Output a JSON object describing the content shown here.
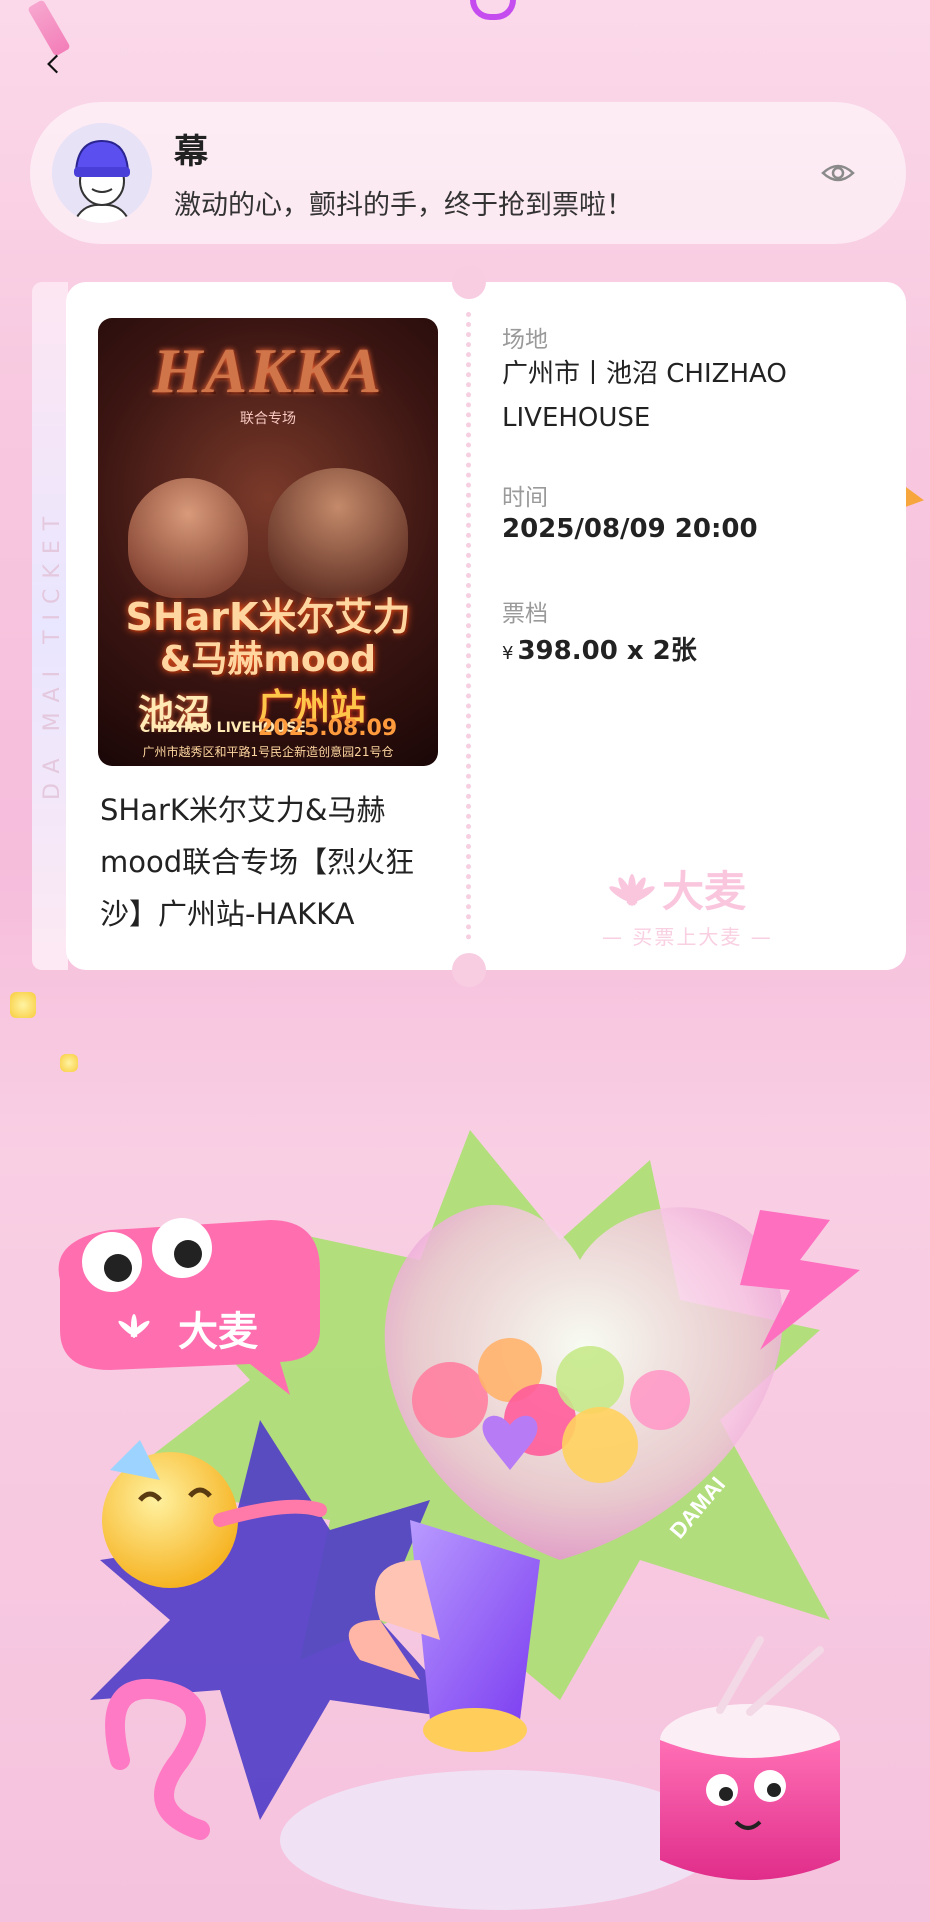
{
  "nav": {
    "back_icon": "chevron-left-icon"
  },
  "message": {
    "name": "幕",
    "text": "激动的心，颤抖的手，终于抢到票啦！",
    "visibility_icon": "eye-icon"
  },
  "ticket": {
    "side_text": "DA MAI TICKET",
    "poster": {
      "title": "HAKKA",
      "subtitle": "联合专场",
      "line1": "SHarK米尔艾力",
      "line2": "&马赫mood",
      "venue": "池沼",
      "city": "广州站",
      "livehouse": "CHIZHAO LIVEHOUSE",
      "date": "2025.08.09",
      "address": "广州市越秀区和平路1号民企新造创意园21号仓"
    },
    "event_title": "SHarK米尔艾力&马赫mood联合专场【烈火狂沙】广州站-HAKKA",
    "venue_label": "场地",
    "venue_value": "广州市丨池沼 CHIZHAO LIVEHOUSE",
    "time_label": "时间",
    "time_value": "2025/08/09 20:00",
    "tier_label": "票档",
    "currency": "¥",
    "tier_value": "398.00 x 2张",
    "watermark_brand": "大麦",
    "watermark_slogan": "— 买票上大麦 —"
  },
  "illustration": {
    "bubble_text": "大麦",
    "tag_text": "DAMAI"
  },
  "colors": {
    "accent_pink": "#f37fb9",
    "background": "#f8c9e0",
    "card": "#ffffff"
  }
}
